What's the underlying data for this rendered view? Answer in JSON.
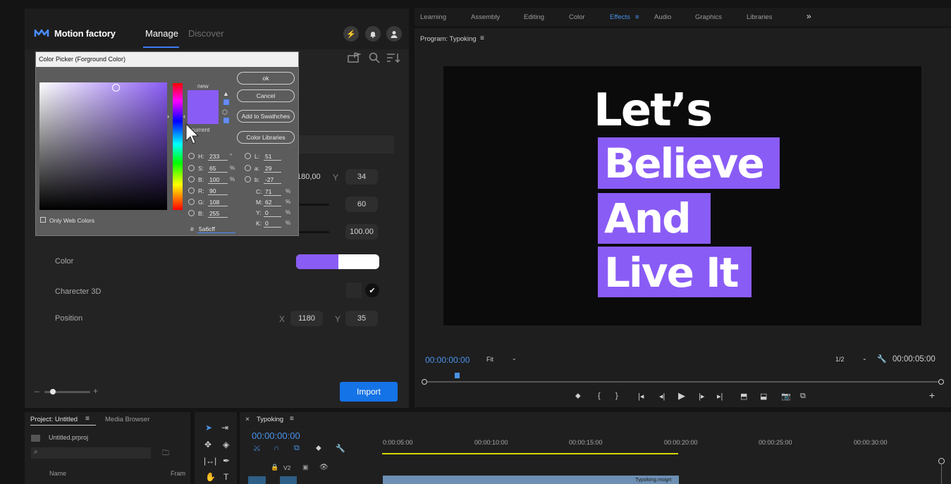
{
  "plugin": {
    "brand": "Motion factory",
    "tabs": [
      "Manage",
      "Discover"
    ],
    "header_icons": [
      "lightning-icon",
      "bell-icon",
      "user-icon"
    ],
    "toolbar_icons": [
      "folder-flag-icon",
      "search-icon",
      "sort-icon"
    ],
    "fields": {
      "row1": {
        "value_x": "180,00",
        "y_label": "Y",
        "value_y": "34"
      },
      "row2": {
        "value": "60"
      },
      "row3": {
        "value": "100.00"
      },
      "color_label": "Color",
      "charecter3d_label": "Charecter 3D",
      "position_label": "Position",
      "position_x_label": "X",
      "position_x": "1180",
      "position_y_label": "Y",
      "position_y": "35"
    },
    "import_button": "Import",
    "accent": "#8a5cf6"
  },
  "color_picker": {
    "title": "Color Picker (Forground Color)",
    "buttons": {
      "ok": "ok",
      "cancel": "Cancel",
      "swatches": "Add to Swathches",
      "libraries": "Color Libraries"
    },
    "new_label": "new",
    "current_label": "current",
    "hsb": [
      {
        "label": "H:",
        "value": "233",
        "unit": "°"
      },
      {
        "label": "S:",
        "value": "65",
        "unit": "%"
      },
      {
        "label": "B:",
        "value": "100",
        "unit": "%"
      }
    ],
    "rgb": [
      {
        "label": "R:",
        "value": "90"
      },
      {
        "label": "G:",
        "value": "108"
      },
      {
        "label": "B:",
        "value": "255"
      }
    ],
    "lab": [
      {
        "label": "L:",
        "value": "51"
      },
      {
        "label": "a:",
        "value": "29"
      },
      {
        "label": "b:",
        "value": "-27"
      }
    ],
    "cmyk": [
      {
        "label": "C:",
        "value": "71",
        "unit": "%"
      },
      {
        "label": "M:",
        "value": "62",
        "unit": "%"
      },
      {
        "label": "Y:",
        "value": "0",
        "unit": "%"
      },
      {
        "label": "K:",
        "value": "0",
        "unit": "%"
      }
    ],
    "hex_label": "#",
    "hex": "5a6cff",
    "only_web_colors": "Only Web Colors",
    "swatch_color": "#8a5cf6"
  },
  "workspaces": [
    "Learning",
    "Assembly",
    "Editing",
    "Color",
    "Effects",
    "Audio",
    "Graphics",
    "Libraries"
  ],
  "active_workspace": "Effects",
  "program_monitor": {
    "title": "Program: Typoking",
    "text_lines": [
      "Let’s",
      "Believe",
      "And",
      "Live It"
    ],
    "timecode": "00:00:00:00",
    "fit": "Fit",
    "resolution": "1/2",
    "duration": "00:00:05:00"
  },
  "project": {
    "tab": "Project: Untitled",
    "media_browser": "Media Browser",
    "file": "Untitled.prproj",
    "name_col": "Name",
    "frame_col": "Fram"
  },
  "timeline": {
    "tab": "Typoking",
    "timecode": "00:00:00:00",
    "ruler": [
      "0:00:05:00",
      "00:00:10:00",
      "00:00:15:00",
      "00:00:20:00",
      "00:00:25:00",
      "00:00:30:00"
    ],
    "track_v2": "V2",
    "clip_name": "Typoking.mogrt"
  }
}
